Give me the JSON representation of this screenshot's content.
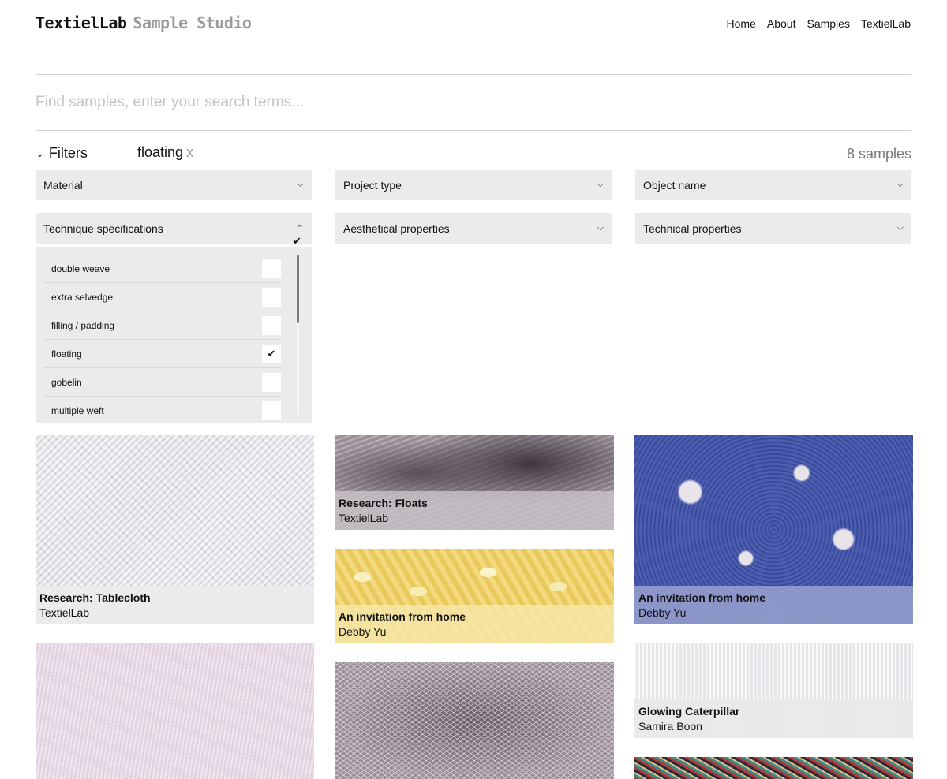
{
  "header": {
    "brand_name": "TextielLab",
    "brand_sub": "Sample Studio",
    "nav": [
      "Home",
      "About",
      "Samples",
      "TextielLab"
    ]
  },
  "search": {
    "placeholder": "Find samples, enter your search terms..."
  },
  "filters": {
    "toggle_label": "Filters",
    "active_tag": "floating",
    "active_tag_remove": "x",
    "count_label": "8 samples",
    "dropdowns": [
      "Material",
      "Project type",
      "Object name",
      "Technique specifications",
      "Aesthetical properties",
      "Technical properties"
    ],
    "technique_options": [
      {
        "label": "double weave",
        "checked": false
      },
      {
        "label": "extra selvedge",
        "checked": false
      },
      {
        "label": "filling / padding",
        "checked": false
      },
      {
        "label": "floating",
        "checked": true
      },
      {
        "label": "gobelin",
        "checked": false
      },
      {
        "label": "multiple weft",
        "checked": false
      }
    ],
    "check_glyph": "✔"
  },
  "icons": {
    "chevron_down": "chevron-down-icon",
    "chevron_up": "chevron-up-icon",
    "check": "check-icon"
  },
  "samples": [
    {
      "title": "Research: Tablecloth",
      "author": "TextielLab"
    },
    {
      "title": "Research: Floats",
      "author": "TextielLab"
    },
    {
      "title": "An invitation from home",
      "author": "Debby Yu"
    },
    {
      "title": "An invitation from home",
      "author": "Debby Yu"
    },
    {
      "title": "Glowing Caterpillar",
      "author": "Samira Boon"
    }
  ]
}
